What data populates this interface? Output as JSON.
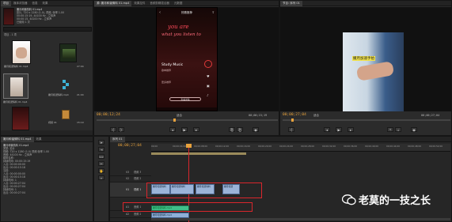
{
  "project": {
    "preview_name": "撇月和谐情料 01.mp4",
    "preview_lines": [
      "影片, 720 x 1280 (1.0), 视频, 帧率 1.00",
      "00:00:15:19, 44100 Hz - 立体声"
    ],
    "preview_lines2": [
      "00:00:15, 44100 Hz - 立体声",
      "已使用 1 次"
    ],
    "tabs": [
      "项目",
      "媒体浏览器",
      "信息",
      "效果"
    ],
    "search_placeholder": "项目 - 1 项",
    "items": [
      {
        "name": "撇月和谐情料 01.mp4",
        "dur": "15:19"
      },
      {
        "name": "序列 01",
        "dur": "27:04"
      },
      {
        "name": "撇月和谐情料 01.mp4",
        "dur": "00:00:02"
      },
      {
        "name": "撇月和谐情料.mp4",
        "dur": "21:04"
      },
      {
        "name": "序列 02",
        "dur": "15:19"
      },
      {
        "name": "视频 01",
        "dur": ""
      }
    ]
  },
  "info": {
    "tabs": [
      "撇月和谐情料 01.mp4",
      "效果"
    ],
    "title": "撇月和谐情料 01.mp4",
    "lines": [
      "类型: 影片",
      "视频: 720 x 1280 (1.0) 视频 帧率 1.00",
      "音频: 44100 Hz - 立体声",
      "磁带名称:",
      "",
      "持续时间: 00:00:15:19",
      "入点: 00:00:00:00",
      "出点: 00:00:15:18",
      "",
      "当前:",
      "入点: 00:00:00:00",
      "出点: 00:00:15:18",
      "持续时间: 1",
      "",
      "入点: 00:00:27:04",
      "出点: 00:00:27:04",
      "持续时间: 1",
      "",
      "出点: 00:00:27:04"
    ]
  },
  "source": {
    "tabs": [
      "源: 撇月和谐情料 01.mp4",
      "效果控件",
      "音频剪辑混合器",
      "元数据"
    ],
    "tc_in": "00;00;12;24",
    "tc_out": "00;00;15;19",
    "fit": "适合",
    "phone": {
      "header": "热歌推荐",
      "neon1": "you are",
      "neon2": "what you listen to",
      "card_title": "Study Music",
      "card_sub": "歌单推荐",
      "card_line": "更多推荐",
      "tag": "查看详情"
    }
  },
  "program": {
    "tabs": [
      "节目: 序列 01"
    ],
    "tc_in": "00;00;27;04",
    "tc_out": "00;00;27;04",
    "fit": "适合",
    "subtitle": "撇月加速手拍"
  },
  "timeline": {
    "tabs": [
      "序列 01"
    ],
    "tc": "00;00;27;04",
    "ruler": [
      "00;00",
      "00;00;04;00",
      "00;00;08;00",
      "00;00;12;00",
      "00;00;16;00",
      "00;00;20;00",
      "00;00;24;00",
      "00;00;28;00",
      "00;00;32;00",
      "00;00;36;00",
      "00;00;40;00",
      "00;00;44;00",
      "00;00;48;00",
      "00;00;52;00"
    ],
    "tracks": [
      {
        "id": "V3",
        "name": "视频 3"
      },
      {
        "id": "V2",
        "name": "视频 2"
      },
      {
        "id": "V1",
        "name": "视频 1"
      },
      {
        "id": "A1",
        "name": "音频 1"
      },
      {
        "id": "A2",
        "name": "音频 2"
      }
    ],
    "v1_clips": [
      "撇月和谐情料",
      "撇月和谐情料",
      "撇月和谐情料",
      "撇月和谐"
    ],
    "a1_clip": "撇月和谐情料.mp4",
    "a2_clip": "撇月和谐情料.mp4"
  },
  "watermark": {
    "text": "老莫的一技之长",
    "icon": "wechat-icon"
  },
  "colors": {
    "accent": "#e8a23c",
    "highlight": "#d9262c",
    "clip": "#9bb4d8",
    "audio": "#3fbf8a"
  }
}
